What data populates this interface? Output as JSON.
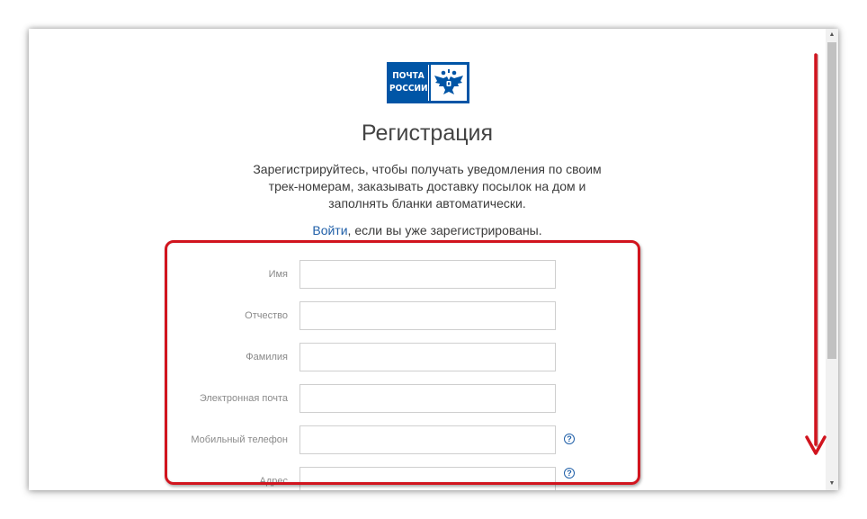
{
  "logo": {
    "line1": "ПОЧТА",
    "line2": "РОССИИ",
    "emblem_icon": "double-headed-eagle-icon",
    "brand_color": "#0055a6"
  },
  "page": {
    "title": "Регистрация",
    "subtitle": "Зарегистрируйтесь, чтобы получать уведомления по своим трек-номерам, заказывать доставку посылок на дом и заполнять бланки автоматически.",
    "login_link": "Войти",
    "login_suffix": ", если вы уже зарегистрированы."
  },
  "form": {
    "fields": [
      {
        "label": "Имя",
        "value": "",
        "help": false
      },
      {
        "label": "Отчество",
        "value": "",
        "help": false
      },
      {
        "label": "Фамилия",
        "value": "",
        "help": false
      },
      {
        "label": "Электронная почта",
        "value": "",
        "help": false
      },
      {
        "label": "Мобильный телефон",
        "value": "",
        "help": true
      },
      {
        "label": "Адрес",
        "value": "",
        "help": true
      }
    ],
    "help_symbol": "?"
  },
  "colors": {
    "link": "#1f5fa8",
    "annotation": "#d1141e"
  },
  "scrollbar": {
    "up_arrow": "▲",
    "down_arrow": "▼"
  }
}
